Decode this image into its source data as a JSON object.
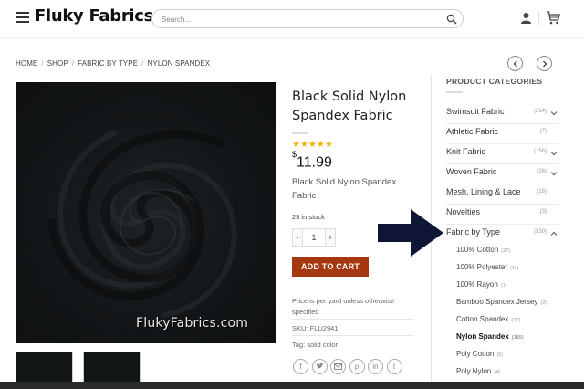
{
  "header": {
    "logo": "Fluky Fabrics",
    "search_placeholder": "Search..."
  },
  "breadcrumb": [
    "HOME",
    "SHOP",
    "FABRIC BY TYPE",
    "NYLON SPANDEX"
  ],
  "product": {
    "title": "Black Solid Nylon Spandex Fabric",
    "stars": "★★★★★",
    "currency": "$",
    "price": "11.99",
    "short_description": "Black Solid Nylon Spandex Fabric",
    "stock": "23 in stock",
    "quantity": "1",
    "qty_minus": "-",
    "qty_plus": "+",
    "add_to_cart": "ADD TO CART",
    "note": "Price is per yard unless otherwise specified",
    "sku_label": "SKU:",
    "sku": "FLU2941",
    "tag_label": "Tag:",
    "tag": "solid color",
    "watermark": "FlukyFabrics.com"
  },
  "share_icons": [
    "facebook-icon",
    "twitter-icon",
    "email-icon",
    "pinterest-icon",
    "linkedin-icon",
    "tumblr-icon"
  ],
  "sidebar": {
    "title": "PRODUCT CATEGORIES",
    "categories": [
      {
        "label": "Swimsuit Fabric",
        "count": "(214)",
        "chevron": "down"
      },
      {
        "label": "Athletic Fabric",
        "count": "(7)",
        "chevron": ""
      },
      {
        "label": "Knit Fabric",
        "count": "(156)",
        "chevron": "down"
      },
      {
        "label": "Woven Fabric",
        "count": "(26)",
        "chevron": "down"
      },
      {
        "label": "Mesh, Lining & Lace",
        "count": "(18)",
        "chevron": ""
      },
      {
        "label": "Novelties",
        "count": "(3)",
        "chevron": ""
      },
      {
        "label": "Fabric by Type",
        "count": "(330)",
        "chevron": "up"
      }
    ],
    "subcategories": [
      {
        "label": "100% Cotton",
        "count": "(27)"
      },
      {
        "label": "100% Polyester",
        "count": "(11)"
      },
      {
        "label": "100% Rayon",
        "count": "(1)"
      },
      {
        "label": "Bamboo Spandex Jersey",
        "count": "(2)"
      },
      {
        "label": "Cotton Spandex",
        "count": "(27)"
      },
      {
        "label": "Nylon Spandex",
        "count": "(185)"
      },
      {
        "label": "Poly Cotton",
        "count": "(5)"
      },
      {
        "label": "Poly Nylon",
        "count": "(4)"
      }
    ]
  },
  "colors": {
    "accent": "#a63810",
    "star": "#f0b30a",
    "arrow": "#0f1535"
  }
}
